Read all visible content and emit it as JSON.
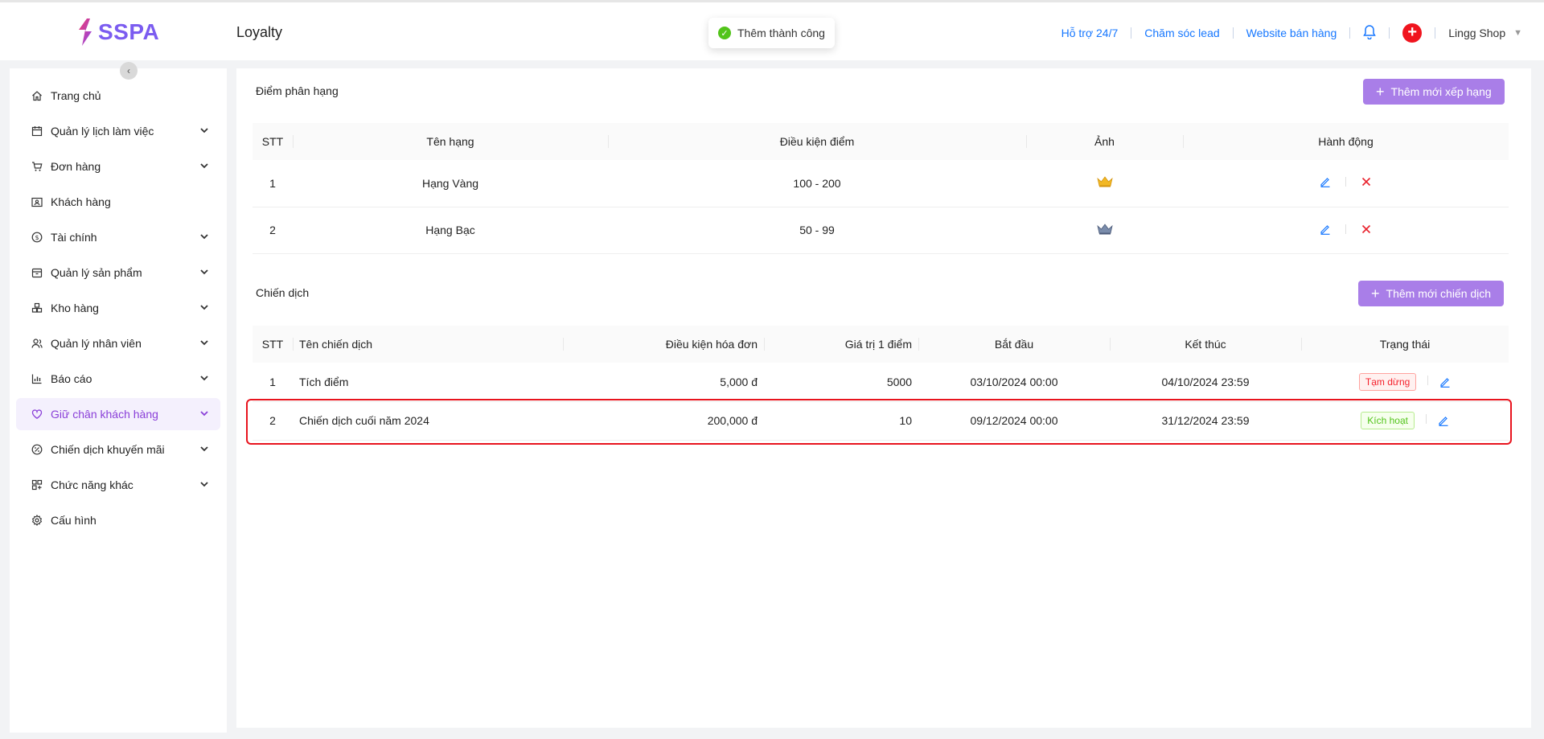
{
  "app": {
    "logo_text": "SSPA",
    "page_title": "Loyalty"
  },
  "toast": {
    "message": "Thêm thành công"
  },
  "header": {
    "links": [
      "Hỗ trợ 24/7",
      "Chăm sóc lead",
      "Website bán hàng"
    ],
    "shop_name": "Lingg Shop"
  },
  "sidebar": {
    "items": [
      {
        "label": "Trang chủ",
        "icon": "home-icon",
        "expandable": false
      },
      {
        "label": "Quản lý lịch làm việc",
        "icon": "calendar-icon",
        "expandable": true
      },
      {
        "label": "Đơn hàng",
        "icon": "cart-icon",
        "expandable": true
      },
      {
        "label": "Khách hàng",
        "icon": "contact-card-icon",
        "expandable": false
      },
      {
        "label": "Tài chính",
        "icon": "dollar-icon",
        "expandable": true
      },
      {
        "label": "Quản lý sản phẩm",
        "icon": "box-icon",
        "expandable": true
      },
      {
        "label": "Kho hàng",
        "icon": "warehouse-icon",
        "expandable": true
      },
      {
        "label": "Quản lý nhân viên",
        "icon": "user-group-icon",
        "expandable": true
      },
      {
        "label": "Báo cáo",
        "icon": "bar-chart-icon",
        "expandable": true
      },
      {
        "label": "Giữ chân khách hàng",
        "icon": "heart-icon",
        "expandable": true,
        "active": true
      },
      {
        "label": "Chiến dịch khuyến mãi",
        "icon": "discount-icon",
        "expandable": true
      },
      {
        "label": "Chức năng khác",
        "icon": "grid-icon",
        "expandable": true
      },
      {
        "label": "Cấu hình",
        "icon": "settings-icon",
        "expandable": false
      }
    ]
  },
  "ranks": {
    "title": "Điểm phân hạng",
    "add_button": "Thêm mới xếp hạng",
    "columns": [
      "STT",
      "Tên hạng",
      "Điều kiện điểm",
      "Ảnh",
      "Hành động"
    ],
    "rows": [
      {
        "stt": "1",
        "name": "Hạng Vàng",
        "condition": "100 - 200",
        "image": "gold-crown-icon"
      },
      {
        "stt": "2",
        "name": "Hạng Bạc",
        "condition": "50 - 99",
        "image": "silver-crown-icon"
      }
    ]
  },
  "campaigns": {
    "title": "Chiến dịch",
    "add_button": "Thêm mới chiến dịch",
    "columns": [
      "STT",
      "Tên chiến dịch",
      "Điều kiện hóa đơn",
      "Giá trị 1 điểm",
      "Bắt đầu",
      "Kết thúc",
      "Trạng thái"
    ],
    "rows": [
      {
        "stt": "1",
        "name": "Tích điểm",
        "invoice_condition": "5,000 đ",
        "point_value": "5000",
        "start": "03/10/2024 00:00",
        "end": "04/10/2024 23:59",
        "status": "Tạm dừng"
      },
      {
        "stt": "2",
        "name": "Chiến dịch cuối năm 2024",
        "invoice_condition": "200,000 đ",
        "point_value": "10",
        "start": "09/12/2024 00:00",
        "end": "31/12/2024 23:59",
        "status": "Kích hoạt"
      }
    ]
  },
  "colors": {
    "brand": "#7b5cf0",
    "button": "#a97ee8",
    "active_menu": "#8a3fd8",
    "link": "#1677ff",
    "highlight": "#e8141e"
  }
}
